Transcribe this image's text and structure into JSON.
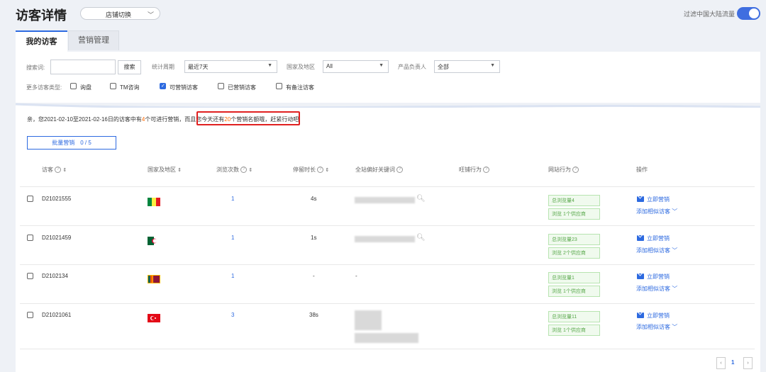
{
  "header": {
    "title": "访客详情",
    "shop_switch_label": "店铺切换",
    "filter_cn_label": "过滤中国大陆流量",
    "filter_cn_on": true
  },
  "tabs": [
    {
      "label": "我的访客",
      "active": true
    },
    {
      "label": "营销管理",
      "active": false
    }
  ],
  "filters": {
    "search_label": "搜索词:",
    "search_value": "",
    "search_button": "搜索",
    "period_label": "统计周期",
    "period_value": "最近7天",
    "region_label": "国家及地区",
    "region_value": "All",
    "owner_label": "产品负责人",
    "owner_value": "全部",
    "type_label": "更多访客类型:",
    "types": [
      {
        "label": "询盘",
        "checked": false
      },
      {
        "label": "TM咨询",
        "checked": false
      },
      {
        "label": "可营销访客",
        "checked": true
      },
      {
        "label": "已营销访客",
        "checked": false
      },
      {
        "label": "有备注访客",
        "checked": false
      }
    ]
  },
  "notice": {
    "part1": "亲，您2021-02-10至2021-02-16日的访客中有",
    "count": "4",
    "part2": "个可进行营销，",
    "part3": "而且您今天还有",
    "quota": "20",
    "part4": "个营销名额哦，",
    "part5": "赶紧行动吧!"
  },
  "batch_button": "批量营销　0 / 5",
  "table": {
    "columns": [
      "访客",
      "国家及地区",
      "浏览次数",
      "停留时长",
      "全站偏好关键词",
      "旺铺行为",
      "网站行为",
      "操作"
    ],
    "rows": [
      {
        "visitor": "D21021555",
        "flag": "senegal",
        "views": "1",
        "duration": "4s",
        "keyword": "",
        "site_total": "总浏览量4",
        "site_suppliers": "浏览 1个供应商"
      },
      {
        "visitor": "D21021459",
        "flag": "algeria",
        "views": "1",
        "duration": "1s",
        "keyword": "",
        "site_total": "总浏览量23",
        "site_suppliers": "浏览 2个供应商"
      },
      {
        "visitor": "D2102134",
        "flag": "sri-lanka",
        "views": "1",
        "duration": "-",
        "keyword": "-",
        "site_total": "总浏览量1",
        "site_suppliers": "浏览 1个供应商"
      },
      {
        "visitor": "D21021061",
        "flag": "turkey",
        "views": "3",
        "duration": "38s",
        "keyword": "",
        "site_total": "总浏览量11",
        "site_suppliers": "浏览 1个供应商"
      }
    ],
    "action_market": "立即营销",
    "action_similar": "添加相似访客"
  },
  "pager": {
    "prev": "‹",
    "current": "1",
    "next": "›"
  },
  "colors": {
    "accent": "#2d6ae0",
    "highlight": "#e02020",
    "orange": "#ff6a00",
    "badge_green": "#58a84b"
  }
}
